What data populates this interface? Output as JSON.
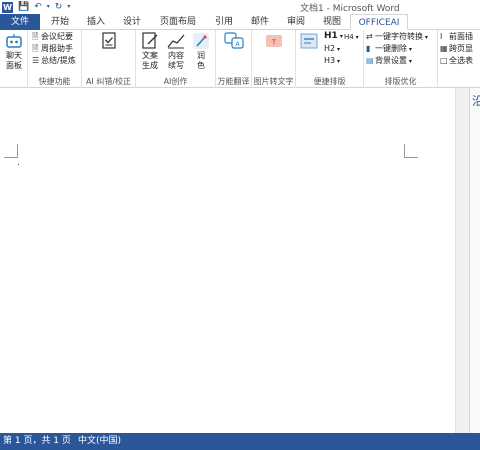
{
  "window": {
    "title": "文档1 - Microsoft Word"
  },
  "tabs": [
    "文件",
    "开始",
    "插入",
    "设计",
    "页面布局",
    "引用",
    "邮件",
    "审阅",
    "视图",
    "OFFICEAI"
  ],
  "ribbon": {
    "chat": {
      "label1": "聊天",
      "label2": "面板"
    },
    "quick": {
      "items": [
        "会议纪要",
        "周报助手",
        "总结/提炼"
      ],
      "group_label": "快捷功能"
    },
    "proofread": {
      "group_label": "AI 纠错/校正"
    },
    "ai_create": {
      "gen": {
        "label1": "文案",
        "label2": "生成"
      },
      "cont": {
        "label1": "内容",
        "label2": "续写"
      },
      "polish": {
        "label1": "润",
        "label2": "色"
      },
      "group_label": "AI创作"
    },
    "translate": {
      "group_label": "万能翻译"
    },
    "img2text": {
      "group_label": "图片转文字"
    },
    "layout": {
      "h1": "H1",
      "h4": "H4",
      "h2": "H2",
      "h3": "H3",
      "group_label": "便捷排版"
    },
    "optimize": {
      "items": [
        "一键字符转换",
        "一键删除",
        "背景设置"
      ],
      "group_label": "排版优化"
    },
    "extra": {
      "items": [
        "前面插",
        "跨页显",
        "全选表"
      ]
    }
  },
  "side_panel": {
    "title": "沿"
  },
  "status": {
    "page": "第 1 页，共 1 页",
    "lang": "中文(中国)"
  },
  "colors": {
    "accent": "#2b579a"
  }
}
